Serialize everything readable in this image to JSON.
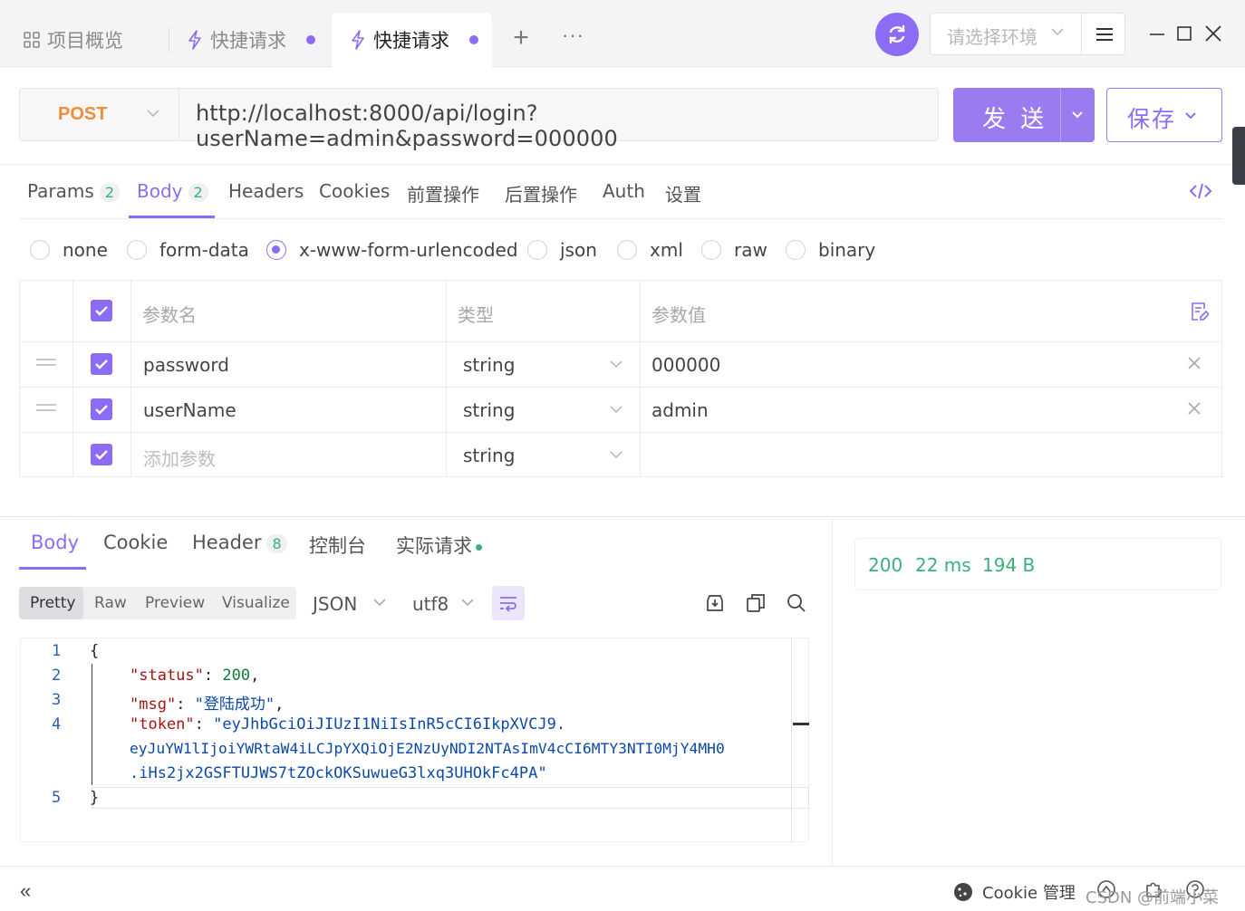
{
  "tabs": [
    {
      "label": "项目概览",
      "icon": "grid-icon"
    },
    {
      "label": "快捷请求",
      "icon": "lightning-icon",
      "unsaved": true
    },
    {
      "label": "快捷请求",
      "icon": "lightning-icon",
      "unsaved": true,
      "active": true
    }
  ],
  "topbar": {
    "add_tab": "+",
    "more": "···",
    "env_placeholder": "请选择环境"
  },
  "request": {
    "method": "POST",
    "url": "http://localhost:8000/api/login?userName=admin&password=000000",
    "send_label": "发 送",
    "save_label": "保存"
  },
  "request_tabs": [
    {
      "label": "Params",
      "badge": "2"
    },
    {
      "label": "Body",
      "badge": "2",
      "active": true
    },
    {
      "label": "Headers"
    },
    {
      "label": "Cookies"
    },
    {
      "label": "前置操作"
    },
    {
      "label": "后置操作"
    },
    {
      "label": "Auth"
    },
    {
      "label": "设置"
    }
  ],
  "body_types": [
    {
      "label": "none",
      "selected": false
    },
    {
      "label": "form-data",
      "selected": false
    },
    {
      "label": "x-www-form-urlencoded",
      "selected": true
    },
    {
      "label": "json",
      "selected": false
    },
    {
      "label": "xml",
      "selected": false
    },
    {
      "label": "raw",
      "selected": false
    },
    {
      "label": "binary",
      "selected": false
    }
  ],
  "params_table": {
    "headers": {
      "name": "参数名",
      "type": "类型",
      "value": "参数值"
    },
    "rows": [
      {
        "name": "password",
        "type": "string",
        "value": "000000",
        "checked": true
      },
      {
        "name": "userName",
        "type": "string",
        "value": "admin",
        "checked": true
      }
    ],
    "new_row": {
      "name_placeholder": "添加参数",
      "type": "string",
      "checked": true
    }
  },
  "response_tabs": [
    {
      "label": "Body",
      "active": true
    },
    {
      "label": "Cookie"
    },
    {
      "label": "Header",
      "badge": "8"
    },
    {
      "label": "控制台"
    },
    {
      "label": "实际请求",
      "dot": true
    }
  ],
  "view_modes": [
    "Pretty",
    "Raw",
    "Preview",
    "Visualize"
  ],
  "view_mode_selected": "Pretty",
  "format": "JSON",
  "encoding": "utf8",
  "response_body": {
    "line_numbers": [
      "1",
      "2",
      "3",
      "4",
      "5"
    ],
    "lines": {
      "open": "{",
      "status_key": "\"status\"",
      "status_val": "200",
      "msg_key": "\"msg\"",
      "msg_val": "\"登陆成功\"",
      "token_key": "\"token\"",
      "token_part1": "\"eyJhbGciOiJIUzI1NiIsInR5cCI6IkpXVCJ9.",
      "token_part2": "eyJuYW1lIjoiYWRtaW4iLCJpYXQiOjE2NzUyNDI2NTAsImV4cCI6MTY3NTI0MjY4MH0",
      "token_part3": ".iHs2jx2GSFTUJWS7tZOckOKSuwueG3lxq3UHOkFc4PA\"",
      "close": "}"
    }
  },
  "response_meta": {
    "status": "200",
    "time": "22 ms",
    "size": "194 B"
  },
  "footer": {
    "collapse": "«",
    "cookie_label": "Cookie 管理",
    "watermark": "CSDN @前端小菜"
  },
  "colors": {
    "accent": "#8c6cf5",
    "method_post": "#f08c38",
    "success": "#3ab07a"
  }
}
